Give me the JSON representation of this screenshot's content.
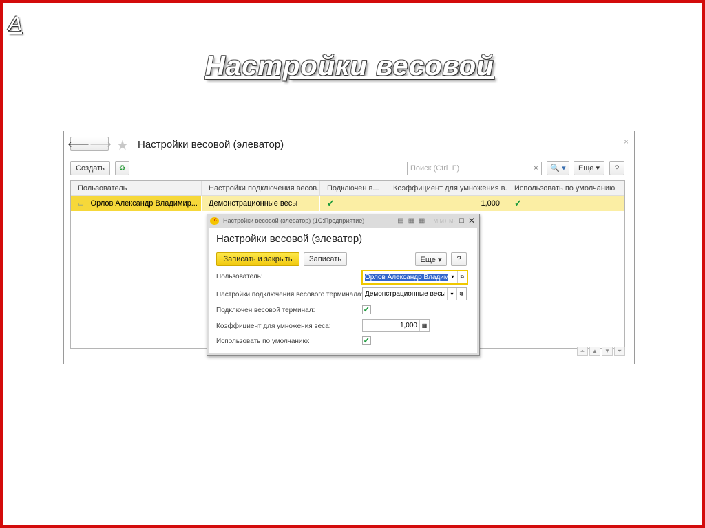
{
  "slide": {
    "letter": "А",
    "title": "Настройки весовой"
  },
  "window": {
    "title": "Настройки весовой (элеватор)",
    "close": "×",
    "create_label": "Создать",
    "search_placeholder": "Поиск (Ctrl+F)",
    "search_clear": "×",
    "more_label": "Еще ▾",
    "help_label": "?",
    "search_btn": "🔍 ▾"
  },
  "table": {
    "columns": [
      "Пользователь",
      "Настройки подключения весов...",
      "Подключен в...",
      "Коэффициент для умножения в...",
      "Использовать по умолчанию"
    ],
    "rows": [
      {
        "user": "Орлов Александр Владимир...",
        "settings": "Демонстрационные весы",
        "connected": "✓",
        "coef": "1,000",
        "default": "✓"
      }
    ]
  },
  "dialog": {
    "window_title": "Настройки весовой (элеватор)  (1С:Предприятие)",
    "title": "Настройки весовой (элеватор)",
    "save_close": "Записать и закрыть",
    "save": "Записать",
    "more": "Еще ▾",
    "help": "?",
    "fields": {
      "user_label": "Пользователь:",
      "user_value": "Орлов Александр Владим",
      "settings_label": "Настройки подключения весового терминала:",
      "settings_value": "Демонстрационные весы",
      "connected_label": "Подключен весовой терминал:",
      "coef_label": "Коэффициент для умножения веса:",
      "coef_value": "1,000",
      "default_label": "Использовать по умолчанию:"
    },
    "connected": true,
    "default": true
  }
}
